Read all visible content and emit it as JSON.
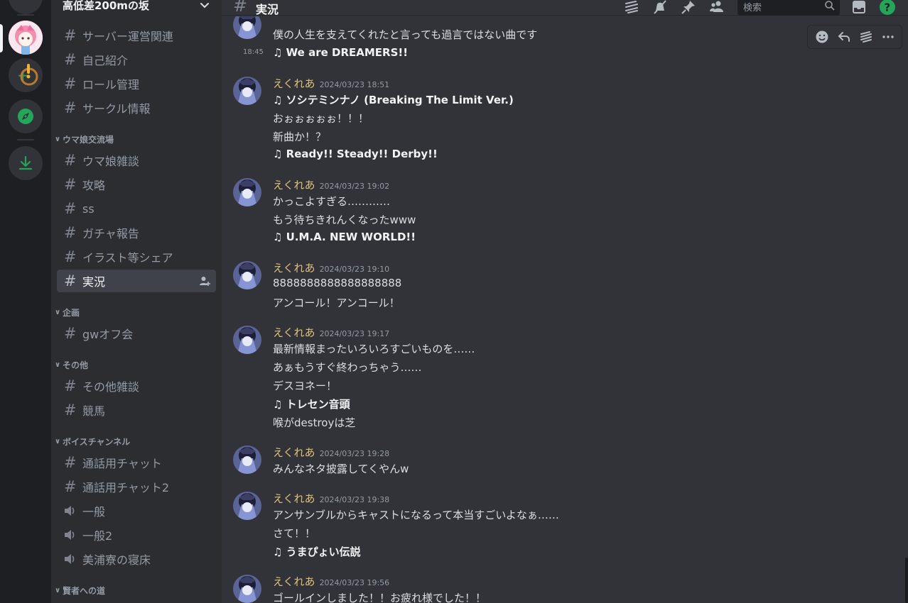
{
  "server": {
    "name": "高低差200mの坂"
  },
  "sidebar": {
    "channels_top": [
      {
        "name": "サーバー運営関連",
        "type": "text"
      },
      {
        "name": "自己紹介",
        "type": "text"
      },
      {
        "name": "ロール管理",
        "type": "text"
      },
      {
        "name": "サークル情報",
        "type": "text"
      }
    ],
    "categories": [
      {
        "name": "ウマ娘交流場",
        "channels": [
          {
            "name": "ウマ娘雑談",
            "type": "text"
          },
          {
            "name": "攻略",
            "type": "text"
          },
          {
            "name": "ss",
            "type": "text"
          },
          {
            "name": "ガチャ報告",
            "type": "text"
          },
          {
            "name": "イラスト等シェア",
            "type": "text"
          },
          {
            "name": "実況",
            "type": "text",
            "active": true
          }
        ]
      },
      {
        "name": "企画",
        "channels": [
          {
            "name": "gwオフ会",
            "type": "text"
          }
        ]
      },
      {
        "name": "その他",
        "channels": [
          {
            "name": "その他雑談",
            "type": "text"
          },
          {
            "name": "競馬",
            "type": "text"
          }
        ]
      },
      {
        "name": "ボイスチャンネル",
        "channels": [
          {
            "name": "通話用チャット",
            "type": "text"
          },
          {
            "name": "通話用チャット2",
            "type": "text"
          },
          {
            "name": "一般",
            "type": "voice"
          },
          {
            "name": "一般2",
            "type": "voice"
          },
          {
            "name": "美浦寮の寝床",
            "type": "voice"
          }
        ]
      },
      {
        "name": "賢者への道",
        "channels": []
      }
    ]
  },
  "header": {
    "channel": "実況",
    "search_placeholder": "検索",
    "icons": [
      "threads-icon",
      "mute-bell-icon",
      "pin-icon",
      "members-icon",
      "inbox-icon",
      "help-icon"
    ]
  },
  "messages": {
    "continuation": {
      "lines": [
        "僕の人生を支えてくれたと言っても過言ではない曲です"
      ],
      "time": "18:45",
      "song": "♫ We are DREAMERS!!"
    },
    "groups": [
      {
        "author": "えくれあ",
        "timestamp": "2024/03/23 18:51",
        "lines": [
          {
            "text": "♫ ソシテミンナノ (Breaking The Limit Ver.)",
            "song": true
          },
          {
            "text": "おぉぉぉぉぉ！！！",
            "song": false
          },
          {
            "text": "新曲か！？",
            "song": false
          },
          {
            "text": "♫ Ready!! Steady!! Derby!!",
            "song": true
          }
        ]
      },
      {
        "author": "えくれあ",
        "timestamp": "2024/03/23 19:02",
        "lines": [
          {
            "text": "かっこよすぎる…………",
            "song": false
          },
          {
            "text": "もう待ちきれんくなったwww",
            "song": false
          },
          {
            "text": "♫ U.M.A. NEW WORLD!!",
            "song": true
          }
        ]
      },
      {
        "author": "えくれあ",
        "timestamp": "2024/03/23 19:10",
        "lines": [
          {
            "text": "8888888888888888888",
            "song": false
          },
          {
            "text": "アンコール！アンコール！",
            "song": false
          }
        ]
      },
      {
        "author": "えくれあ",
        "timestamp": "2024/03/23 19:17",
        "lines": [
          {
            "text": "最新情報まったいろいろすごいものを……",
            "song": false
          },
          {
            "text": "あぁもうすぐ終わっちゃう……",
            "song": false
          },
          {
            "text": "デスヨネー！",
            "song": false
          },
          {
            "text": "♫ トレセン音頭",
            "song": true
          },
          {
            "text": "喉がdestroyは芝",
            "song": false
          }
        ]
      },
      {
        "author": "えくれあ",
        "timestamp": "2024/03/23 19:28",
        "lines": [
          {
            "text": "みんなネタ披露してくやんw",
            "song": false
          }
        ]
      },
      {
        "author": "えくれあ",
        "timestamp": "2024/03/23 19:38",
        "lines": [
          {
            "text": "アンサンブルからキャストになるって本当すごいよなぁ……",
            "song": false
          },
          {
            "text": "さて！！",
            "song": false
          },
          {
            "text": "♫ うまぴょい伝説",
            "song": true
          }
        ]
      },
      {
        "author": "えくれあ",
        "timestamp": "2024/03/23 19:56",
        "lines": [
          {
            "text": "ゴールインしました！！お疲れ様でした！！",
            "song": false
          }
        ]
      }
    ]
  },
  "colors": {
    "rail": "#1e1f22",
    "sidebar": "#2b2d31",
    "chat": "#313338",
    "username": "#e1c07b",
    "green": "#23a55a"
  }
}
